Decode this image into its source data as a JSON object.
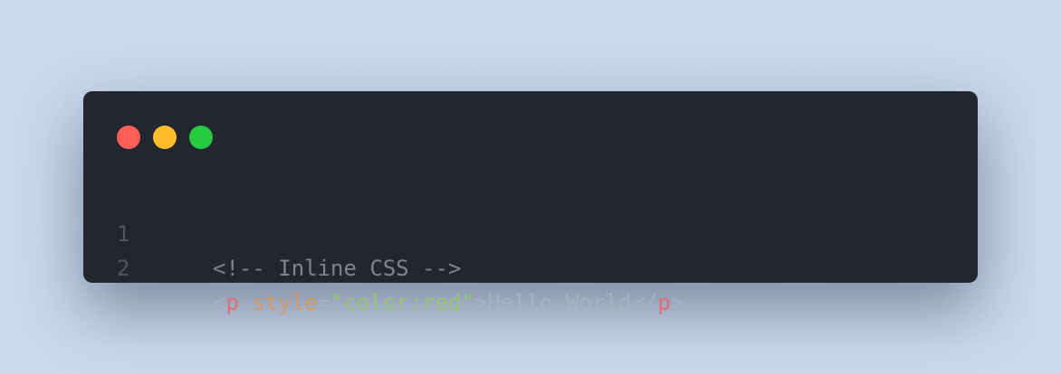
{
  "window": {
    "controls": [
      {
        "name": "close",
        "color": "#ff5f56"
      },
      {
        "name": "minimize",
        "color": "#ffbd2e"
      },
      {
        "name": "maximize",
        "color": "#27c93f"
      }
    ]
  },
  "code": {
    "lines": [
      {
        "number": "1",
        "comment": "<!-- Inline CSS -->"
      },
      {
        "number": "2",
        "open_lt": "<",
        "tag_name": "p",
        "space": " ",
        "attr_name": "style",
        "equals": "=",
        "attr_value": "\"color:red\"",
        "open_gt": ">",
        "content": "Hello World",
        "close_lt": "</",
        "close_tag_name": "p",
        "close_gt": ">"
      }
    ]
  },
  "colors": {
    "background": "#cbd9f0",
    "editor_background": "#22262f",
    "line_number": "#4f5563",
    "comment": "#7c8391",
    "tag": "#e06c75",
    "attribute": "#d19a66",
    "string": "#98c379",
    "text": "#abb2bf"
  }
}
